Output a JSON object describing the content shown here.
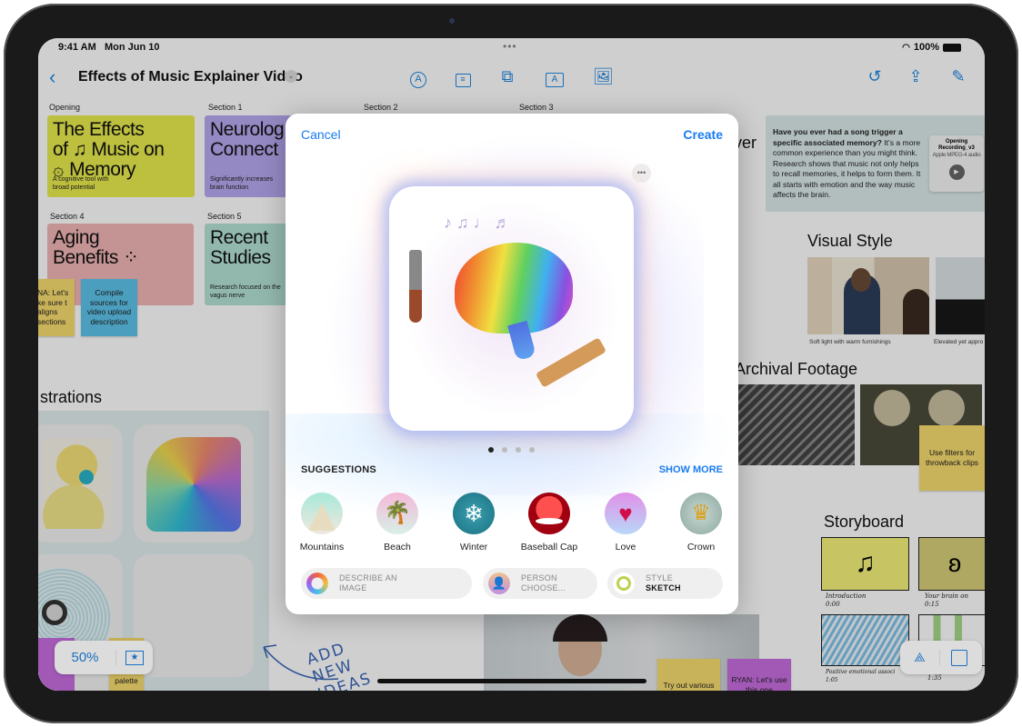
{
  "status_bar": {
    "time": "9:41 AM",
    "date": "Mon Jun 10",
    "battery": "100%"
  },
  "nav": {
    "title": "Effects of Music Explainer Video",
    "tools": [
      "pen-icon",
      "text-box-icon",
      "shapes-icon",
      "text-icon",
      "media-icon"
    ],
    "right_tools": [
      "undo-icon",
      "share-icon",
      "compose-icon"
    ]
  },
  "board": {
    "sections": [
      {
        "label": "Opening",
        "title": "The Effects of ♫ Music on ⚙ Memory",
        "title_lines": [
          "The Effects",
          "of ♫ Music on",
          "۞ Memory"
        ],
        "subtitle": "A cognitive tool with broad potential",
        "color": "#e9ec4e"
      },
      {
        "label": "Section 1",
        "title_lines": [
          "Neurolog",
          "Connect"
        ],
        "subtitle": "Significantly increases brain function",
        "color": "#b8a9f2"
      },
      {
        "label": "Section 2"
      },
      {
        "label": "Section 3"
      },
      {
        "label": "Section 4",
        "title_lines": [
          "Aging",
          "Benefits ⁘"
        ],
        "subtitle": "",
        "color": "#f2b6b6"
      },
      {
        "label": "Section 5",
        "title_lines": [
          "Recent",
          "Studies"
        ],
        "subtitle": "Research focused on the vagus nerve",
        "color": "#b4e3d6"
      }
    ],
    "stickies": {
      "left_yellow": "NA: Let's ke sure t aligns sections",
      "compile": "Compile sources for video upload description",
      "filters": "Use filters for throwback clips",
      "try_out": "Try out various",
      "ryan": "RYAN: Let's use this one",
      "palette": "palette"
    },
    "partial_heading": "ver",
    "quote": {
      "bold": "Have you ever had a song trigger a specific associated memory?",
      "rest": " It's a more common experience than you might think. Research shows that music not only helps to recall memories, it helps to form them. It all starts with emotion and the way music affects the brain."
    },
    "audio": {
      "title": "Opening Recording_v3",
      "subtitle": "Apple MPEG-4 audio"
    },
    "visual_style": {
      "heading": "Visual Style",
      "captions": [
        "Soft light with warm furnishings",
        "Elevated yet appro"
      ]
    },
    "archival": {
      "heading": "Archival Footage"
    },
    "illustrations": {
      "heading": "strations"
    },
    "storyboard": {
      "heading": "Storyboard",
      "frames": [
        {
          "caption": "Introduction",
          "time": "0:00"
        },
        {
          "caption": "Your brain on",
          "time": "0:15"
        },
        {
          "caption": "Positive emotional associ",
          "time": "1:05"
        },
        {
          "caption": "",
          "time": "1:35"
        }
      ]
    },
    "handwriting": "ADD NEW IDEAS",
    "zoom_level": "50%"
  },
  "modal": {
    "cancel": "Cancel",
    "create": "Create",
    "page_count": 4,
    "current_page": 1,
    "suggestions_label": "SUGGESTIONS",
    "show_more": "SHOW MORE",
    "suggestions": [
      "Mountains",
      "Beach",
      "Winter",
      "Baseball Cap",
      "Love",
      "Crown"
    ],
    "describe": {
      "line1": "DESCRIBE AN",
      "line2": "IMAGE"
    },
    "person": {
      "line1": "PERSON",
      "line2": "CHOOSE..."
    },
    "style": {
      "line1": "STYLE",
      "line2": "SKETCH"
    },
    "accent": "#1a7cf0"
  }
}
